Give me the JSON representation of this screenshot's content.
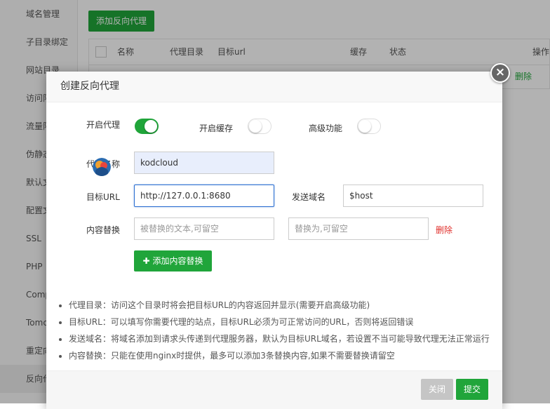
{
  "sidebar": {
    "items": [
      {
        "label": "域名管理"
      },
      {
        "label": "子目录绑定"
      },
      {
        "label": "网站目录"
      },
      {
        "label": "访问限制"
      },
      {
        "label": "流量限制"
      },
      {
        "label": "伪静态"
      },
      {
        "label": "默认文档"
      },
      {
        "label": "配置文件"
      },
      {
        "label": "SSL"
      },
      {
        "label": "PHP"
      },
      {
        "label": "Composer"
      },
      {
        "label": "Tomcat"
      },
      {
        "label": "重定向"
      },
      {
        "label": "反向代理"
      }
    ]
  },
  "background": {
    "add_button": "添加反向代理",
    "table_headers": {
      "name": "名称",
      "proxy_dir": "代理目录",
      "target_url": "目标url",
      "cache": "缓存",
      "status": "状态",
      "action": "操作"
    },
    "row_delete": "删除"
  },
  "modal": {
    "title": "创建反向代理",
    "close_symbol": "×",
    "enable_proxy_label": "开启代理",
    "enable_proxy_on": true,
    "enable_cache_label": "开启缓存",
    "enable_cache_on": false,
    "advanced_label": "高级功能",
    "advanced_on": false,
    "proxy_name_label": "代理名称",
    "proxy_name_value": "kodcloud",
    "target_url_label": "目标URL",
    "target_url_value": "http://127.0.0.1:8680",
    "send_domain_label": "发送域名",
    "send_domain_value": "$host",
    "content_replace_label": "内容替换",
    "replace_from_placeholder": "被替换的文本,可留空",
    "replace_to_placeholder": "替换为,可留空",
    "delete_link": "删除",
    "add_replace_button": "添加内容替换",
    "notes": [
      "代理目录：访问这个目录时将会把目标URL的内容返回并显示(需要开启高级功能)",
      "目标URL：可以填写你需要代理的站点，目标URL必须为可正常访问的URL，否则将返回错误",
      "发送域名：将域名添加到请求头传递到代理服务器，默认为目标URL域名，若设置不当可能导致代理无法正常运行",
      "内容替换：只能在使用nginx时提供，最多可以添加3条替换内容,如果不需要替换请留空"
    ],
    "close_button": "关闭",
    "submit_button": "提交"
  },
  "colors": {
    "accent_green": "#20a53a",
    "danger_red": "#e0302c",
    "focus_blue": "#2c6fd1"
  }
}
